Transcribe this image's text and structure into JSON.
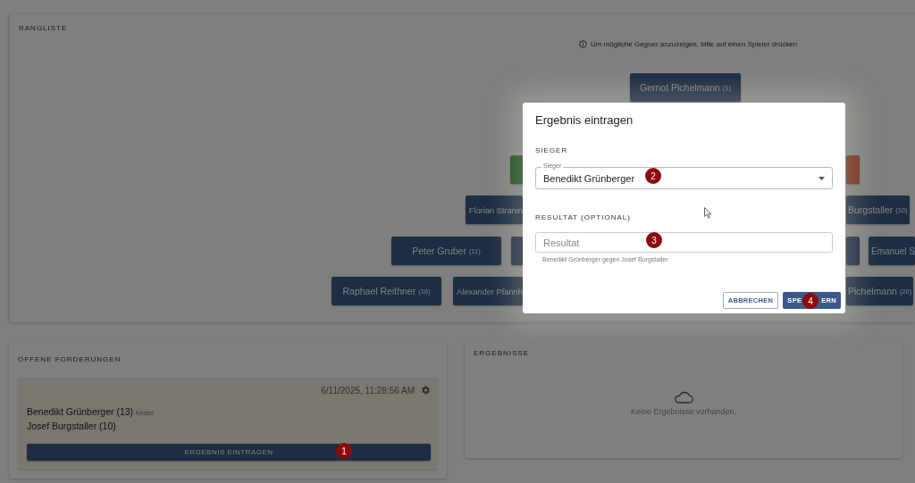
{
  "ranking": {
    "title": "RANGLISTE",
    "hint": "Um mögliche Gegner anzuzeigen, bitte auf einen Spieler drücken",
    "rows": [
      {
        "players": [
          {
            "kind": "normal",
            "name": "Gernot Pichelmann",
            "rank": "(1)"
          }
        ]
      },
      {
        "players": [
          {
            "kind": "challenger"
          },
          {
            "kind": "challenged"
          }
        ]
      },
      {
        "players": [
          {
            "kind": "normal",
            "name": "Florian Stranin"
          },
          {
            "kind": "normal",
            "name": "Burgstaller",
            "rank": "(10)"
          }
        ]
      },
      {
        "players": [
          {
            "kind": "normal",
            "name": "Peter Gruber",
            "rank": "(11)"
          },
          {
            "kind": "normal"
          },
          {
            "kind": "normal"
          },
          {
            "kind": "normal",
            "name": "Emanuel S"
          }
        ]
      },
      {
        "players": [
          {
            "kind": "normal",
            "name": "Raphael Reithner",
            "rank": "(16)"
          },
          {
            "kind": "normal",
            "name": "Alexander Pfannh"
          },
          {
            "kind": "normal",
            "name": "Pichelmann",
            "rank": "(20)"
          }
        ]
      }
    ]
  },
  "open_challenges": {
    "title": "OFFENE FORDERUNGEN",
    "items": [
      {
        "timestamp": "6/11/2025, 11:28:56 AM",
        "challenger": "Benedikt Grünberger (13)",
        "verb": "fordert",
        "challenged": "Josef Burgstaller (10)",
        "button": "ERGEBNIS EINTRAGEN"
      }
    ]
  },
  "results": {
    "title": "ERGEBNISSE",
    "empty_text": "Keine Ergebnisse vorhanden."
  },
  "dialog": {
    "title": "Ergebnis eintragen",
    "winner_section": "SIEGER",
    "winner_label": "Sieger",
    "winner_value": "Benedikt Grünberger",
    "result_section": "RESULTAT (OPTIONAL)",
    "result_placeholder": "Resultat",
    "result_hint": "Benedikt Grünberger gegen Josef Burgstaller",
    "buttons": [
      {
        "kind": "outlined",
        "label": "ABBRECHEN"
      },
      {
        "kind": "filled",
        "label_parts": [
          "SPE",
          "ERN"
        ]
      }
    ]
  },
  "markers": [
    {
      "label": "1"
    },
    {
      "label": "2"
    },
    {
      "label": "3"
    },
    {
      "label": "4"
    }
  ]
}
